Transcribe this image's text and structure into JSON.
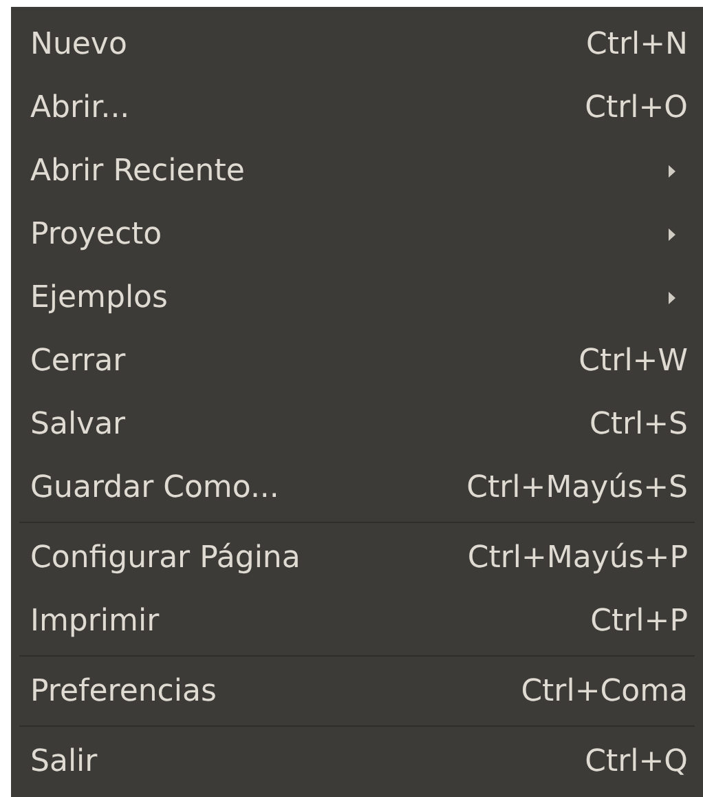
{
  "menu": {
    "groups": [
      {
        "items": [
          {
            "label": "Nuevo",
            "kind": "shortcut",
            "shortcut": "Ctrl+N"
          },
          {
            "label": "Abrir...",
            "kind": "shortcut",
            "shortcut": "Ctrl+O"
          },
          {
            "label": "Abrir Reciente",
            "kind": "submenu"
          },
          {
            "label": "Proyecto",
            "kind": "submenu"
          },
          {
            "label": "Ejemplos",
            "kind": "submenu"
          },
          {
            "label": "Cerrar",
            "kind": "shortcut",
            "shortcut": "Ctrl+W"
          },
          {
            "label": "Salvar",
            "kind": "shortcut",
            "shortcut": "Ctrl+S"
          },
          {
            "label": "Guardar Como...",
            "kind": "shortcut",
            "shortcut": "Ctrl+Mayús+S"
          }
        ]
      },
      {
        "items": [
          {
            "label": "Configurar Página",
            "kind": "shortcut",
            "shortcut": "Ctrl+Mayús+P"
          },
          {
            "label": "Imprimir",
            "kind": "shortcut",
            "shortcut": "Ctrl+P"
          }
        ]
      },
      {
        "items": [
          {
            "label": "Preferencias",
            "kind": "shortcut",
            "shortcut": "Ctrl+Coma"
          }
        ]
      },
      {
        "items": [
          {
            "label": "Salir",
            "kind": "shortcut",
            "shortcut": "Ctrl+Q"
          }
        ]
      }
    ]
  }
}
